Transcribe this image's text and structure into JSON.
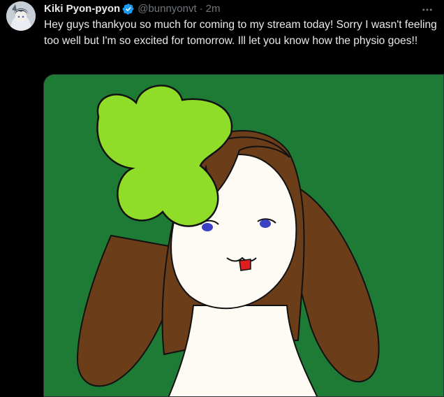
{
  "tweet": {
    "display_name": "Kiki Pyon-pyon",
    "handle": "@bunnyonvt",
    "separator": "·",
    "timestamp": "2m",
    "text": "Hey guys thankyou so much for coming to my stream today! Sorry I wasn't feeling too well but I'm so excited for tomorrow. Ill let you know how the physio goes!!",
    "icons": {
      "verified": "verified-badge-icon",
      "more": "more-options-icon"
    },
    "colors": {
      "background": "#000000",
      "text": "#e7e9ea",
      "secondary_text": "#71767b",
      "verified_blue": "#1d9bf0",
      "image_background": "#1e7b35",
      "clover_green": "#8fdd28",
      "hair_brown": "#6b3d18",
      "skin": "#fdfbf3"
    }
  }
}
